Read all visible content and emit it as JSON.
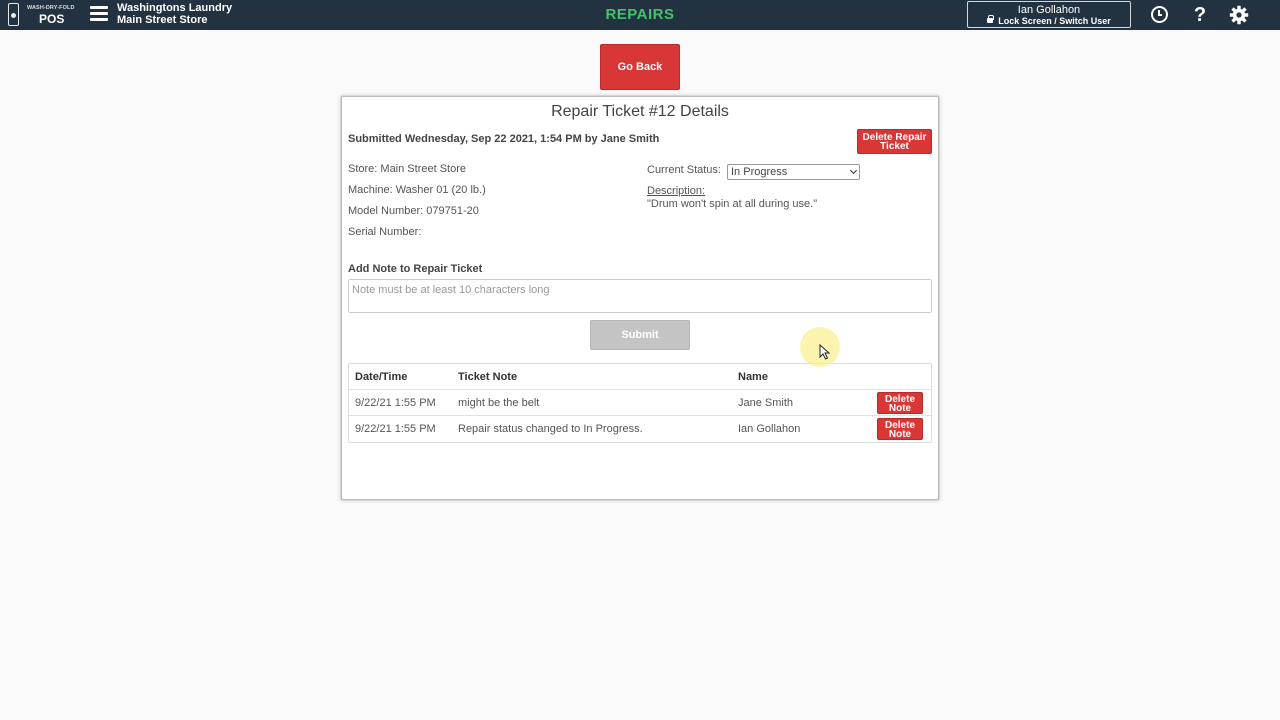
{
  "header": {
    "logo_small": "WASH-DRY-FOLD",
    "logo_main": "POS",
    "business_name": "Washingtons Laundry",
    "store_name": "Main Street Store",
    "page_title": "REPAIRS",
    "user_name": "Ian Gollahon",
    "lock_label": "Lock Screen / Switch User",
    "help_glyph": "?",
    "icons": [
      "menu-icon",
      "lock-icon",
      "clock-icon",
      "help-icon",
      "gear-icon"
    ]
  },
  "go_back_label": "Go Back",
  "ticket": {
    "title": "Repair Ticket #12 Details",
    "submitted": "Submitted Wednesday, Sep 22 2021, 1:54 PM by Jane Smith",
    "delete_label": "Delete Repair Ticket",
    "store": "Store: Main Street Store",
    "machine": "Machine: Washer 01 (20 lb.)",
    "model": "Model Number: 079751-20",
    "serial": "Serial Number:",
    "status_label": "Current Status:",
    "status_value": "In Progress",
    "description_label": "Description:",
    "description_text": "\"Drum won't spin at all during use.\""
  },
  "note_form": {
    "label": "Add Note to Repair Ticket",
    "placeholder": "Note must be at least 10 characters long",
    "value": "",
    "submit_label": "Submit"
  },
  "notes_table": {
    "headers": [
      "Date/Time",
      "Ticket Note",
      "Name"
    ],
    "rows": [
      {
        "datetime": "9/22/21 1:55 PM",
        "note": "might be the belt",
        "name": "Jane Smith",
        "delete_label": "Delete Note"
      },
      {
        "datetime": "9/22/21 1:55 PM",
        "note": "Repair status changed to In Progress.",
        "name": "Ian Gollahon",
        "delete_label": "Delete Note"
      }
    ]
  },
  "colors": {
    "header_bg": "#233240",
    "title_green": "#3fc46a",
    "danger": "#d93636",
    "disabled": "#c4c4c4"
  }
}
